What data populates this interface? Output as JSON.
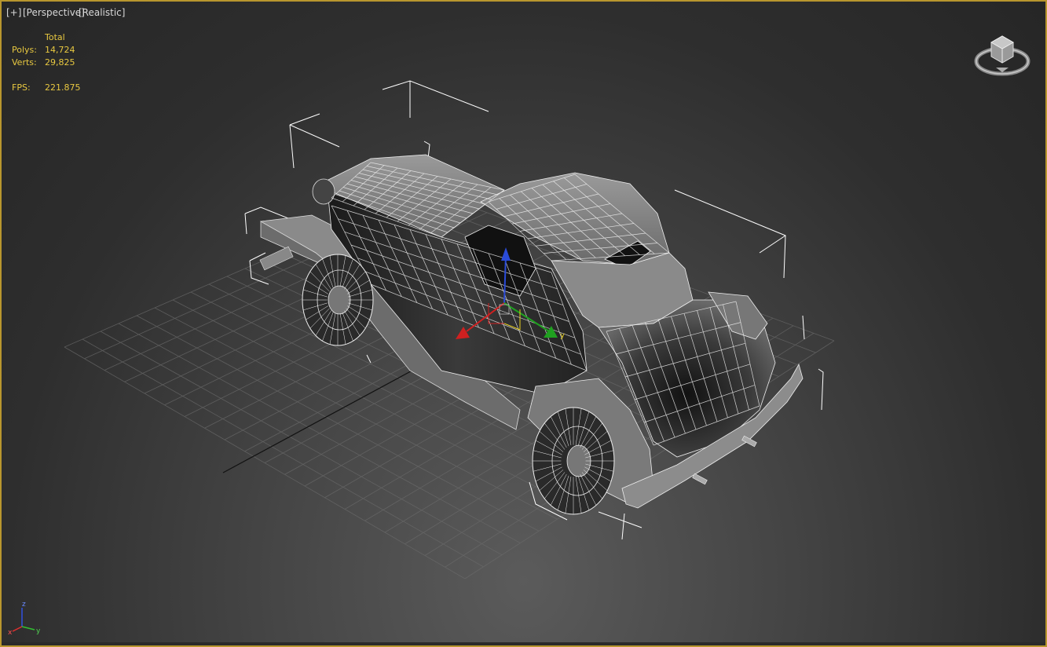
{
  "viewport": {
    "labels": [
      "[+]",
      "[Perspective]",
      "[Realistic]"
    ],
    "active_border_color": "#b8962e"
  },
  "stats": {
    "header": "Total",
    "polys_label": "Polys:",
    "polys_value": "14,724",
    "verts_label": "Verts:",
    "verts_value": "29,825",
    "fps_label": "FPS:",
    "fps_value": "221.875",
    "text_color": "#e8c840"
  },
  "viewcube": {
    "icon": "viewcube-icon"
  },
  "axis_tripod": {
    "x_label": "x",
    "y_label": "y",
    "z_label": "z"
  },
  "scene": {
    "object": "car-wireframe-mesh",
    "gizmo": "transform-gizmo-icon",
    "grid": "home-grid"
  }
}
